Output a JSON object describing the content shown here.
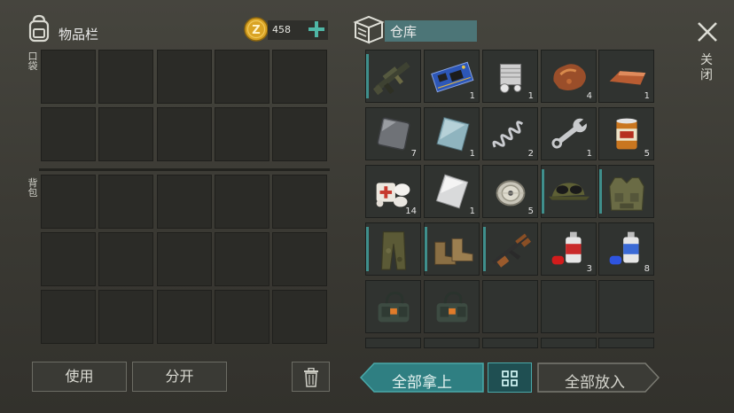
{
  "inventory": {
    "title": "物品栏",
    "pocket_label": "口袋",
    "backpack_label": "背包",
    "coins": "458",
    "use_button": "使用",
    "split_button": "分开"
  },
  "storage": {
    "title": "仓库",
    "take_all_button": "全部拿上",
    "put_all_button": "全部放入",
    "items": [
      {
        "name": "rifle-icon",
        "count": ""
      },
      {
        "name": "circuit-board-icon",
        "count": "1"
      },
      {
        "name": "engine-block-icon",
        "count": "1"
      },
      {
        "name": "copper-ore-icon",
        "count": "4"
      },
      {
        "name": "copper-ingot-icon",
        "count": "1"
      },
      {
        "name": "metal-plate-icon",
        "count": "7"
      },
      {
        "name": "steel-sheet-icon",
        "count": "1"
      },
      {
        "name": "spring-icon",
        "count": "2"
      },
      {
        "name": "wrench-icon",
        "count": "1"
      },
      {
        "name": "canned-food-icon",
        "count": "5"
      },
      {
        "name": "bandage-icon",
        "count": "14"
      },
      {
        "name": "aluminum-sheet-icon",
        "count": "1"
      },
      {
        "name": "wire-spool-icon",
        "count": "5"
      },
      {
        "name": "cap-with-goggles-icon",
        "count": ""
      },
      {
        "name": "tactical-vest-icon",
        "count": ""
      },
      {
        "name": "camo-pants-icon",
        "count": ""
      },
      {
        "name": "boots-icon",
        "count": ""
      },
      {
        "name": "ak-rifle-icon",
        "count": ""
      },
      {
        "name": "red-spray-can-icon",
        "count": "3"
      },
      {
        "name": "blue-spray-can-icon",
        "count": "8"
      },
      {
        "name": "supply-bag-icon",
        "count": ""
      },
      {
        "name": "supply-bag-icon",
        "count": ""
      }
    ]
  },
  "close_label": "关闭",
  "colors": {
    "accent": "#3f8f8c",
    "teal_button": "#2f7f82",
    "coin": "#d9a324"
  }
}
